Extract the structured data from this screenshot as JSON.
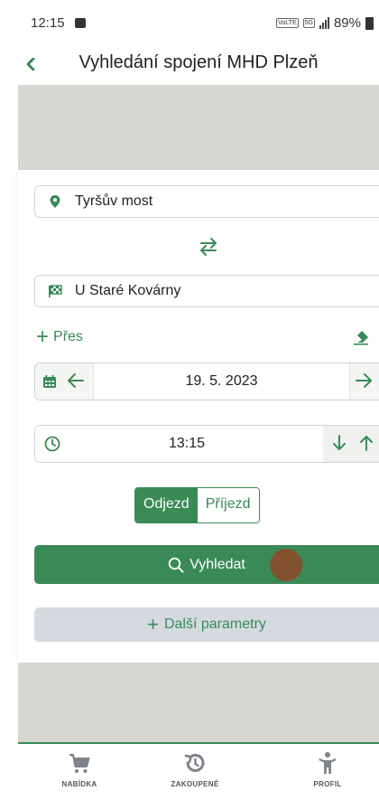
{
  "status_bar": {
    "time": "12:15",
    "network": "VoLTE",
    "network_gen": "5G",
    "battery": "89%"
  },
  "header": {
    "title": "Vyhledání spojení MHD Plzeň",
    "back_icon": "chevron-left-icon"
  },
  "search_form": {
    "from": "Tyršův most",
    "to": "U Staré Kovárny",
    "via_label": "Přes",
    "date": "19. 5. 2023",
    "time": "13:15",
    "mode_options": [
      "Odjezd",
      "Příjezd"
    ],
    "selected_mode": "Odjezd",
    "search_label": "Vyhledat",
    "more_params_label": "Další parametry"
  },
  "bottom_nav": {
    "items": [
      {
        "label": "NABÍDKA",
        "icon": "cart-icon"
      },
      {
        "label": "ZAKOUPENÉ",
        "icon": "history-icon"
      },
      {
        "label": "PROFIL",
        "icon": "person-icon"
      }
    ]
  },
  "colors": {
    "accent": "#3a8a57",
    "panel_gray": "#d6d7d1",
    "secondary_button": "#d5dae0"
  }
}
